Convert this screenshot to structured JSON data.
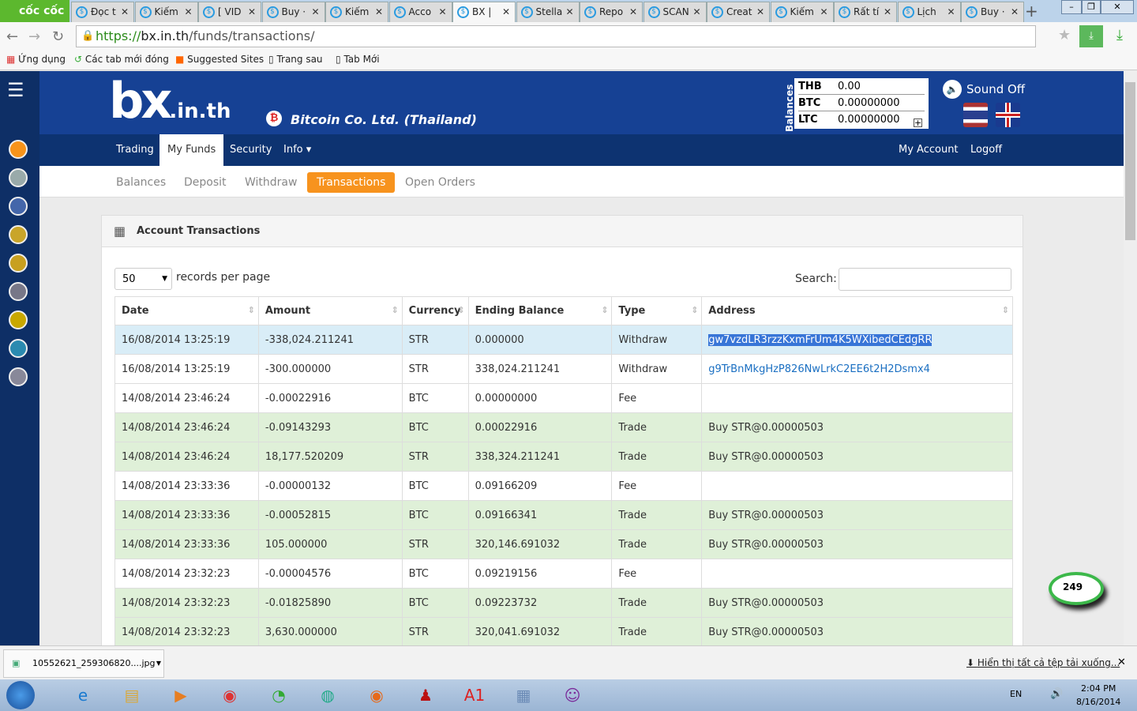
{
  "browser": {
    "logo": "cốc cốc",
    "tabs": [
      "Đọc t",
      "Kiếm",
      "[ VID",
      "Buy ·",
      "Kiếm",
      "Acco",
      "BX |",
      "Stella",
      "Repo",
      "SCAN",
      "Creat",
      "Kiếm",
      "Rất tí",
      "Lịch",
      "Buy ·"
    ],
    "url_scheme": "https://",
    "url_host": "bx.in.th",
    "url_path": "/funds/transactions/",
    "bookmarks": [
      "Ứng dụng",
      "Các tab mới đóng",
      "Suggested Sites",
      "Trang sau",
      "Tab Mới"
    ]
  },
  "site": {
    "logo": "bx.in.th",
    "company": "Bitcoin Co. Ltd. (Thailand)",
    "balances_label": "Balances",
    "balances": [
      {
        "cur": "THB",
        "val": "0.00"
      },
      {
        "cur": "BTC",
        "val": "0.00000000"
      },
      {
        "cur": "LTC",
        "val": "0.00000000"
      }
    ],
    "sound": "Sound Off",
    "nav": [
      "Trading",
      "My Funds",
      "Security",
      "Info ▾"
    ],
    "nav_right": [
      "My Account",
      "Logoff"
    ],
    "subnav": [
      "Balances",
      "Deposit",
      "Withdraw",
      "Transactions",
      "Open Orders"
    ]
  },
  "panel": {
    "title": "Account Transactions",
    "page_size": "50",
    "records_label": "records per page",
    "search_label": "Search:",
    "search_value": "",
    "columns": [
      "Date",
      "Amount",
      "Currency",
      "Ending Balance",
      "Type",
      "Address"
    ],
    "rows": [
      [
        "16/08/2014 13:25:19",
        "-338,024.211241",
        "STR",
        "0.000000",
        "Withdraw",
        "gw7vzdLR3rzzKxmFrUm4K5WXibedCEdgRR"
      ],
      [
        "16/08/2014 13:25:19",
        "-300.000000",
        "STR",
        "338,024.211241",
        "Withdraw",
        "g9TrBnMkgHzP826NwLrkC2EE6t2H2Dsmx4"
      ],
      [
        "14/08/2014 23:46:24",
        "-0.00022916",
        "BTC",
        "0.00000000",
        "Fee",
        ""
      ],
      [
        "14/08/2014 23:46:24",
        "-0.09143293",
        "BTC",
        "0.00022916",
        "Trade",
        "Buy STR@0.00000503"
      ],
      [
        "14/08/2014 23:46:24",
        "18,177.520209",
        "STR",
        "338,324.211241",
        "Trade",
        "Buy STR@0.00000503"
      ],
      [
        "14/08/2014 23:33:36",
        "-0.00000132",
        "BTC",
        "0.09166209",
        "Fee",
        ""
      ],
      [
        "14/08/2014 23:33:36",
        "-0.00052815",
        "BTC",
        "0.09166341",
        "Trade",
        "Buy STR@0.00000503"
      ],
      [
        "14/08/2014 23:33:36",
        "105.000000",
        "STR",
        "320,146.691032",
        "Trade",
        "Buy STR@0.00000503"
      ],
      [
        "14/08/2014 23:32:23",
        "-0.00004576",
        "BTC",
        "0.09219156",
        "Fee",
        ""
      ],
      [
        "14/08/2014 23:32:23",
        "-0.01825890",
        "BTC",
        "0.09223732",
        "Trade",
        "Buy STR@0.00000503"
      ],
      [
        "14/08/2014 23:32:23",
        "3,630.000000",
        "STR",
        "320,041.691032",
        "Trade",
        "Buy STR@0.00000503"
      ]
    ]
  },
  "chat_badge": "249",
  "download": {
    "file": "10552621_259306820....jpg",
    "show_all": "Hiển thị tất cả tệp tải xuống..."
  },
  "taskbar": {
    "lang": "EN",
    "time": "2:04 PM",
    "date": "8/16/2014"
  }
}
